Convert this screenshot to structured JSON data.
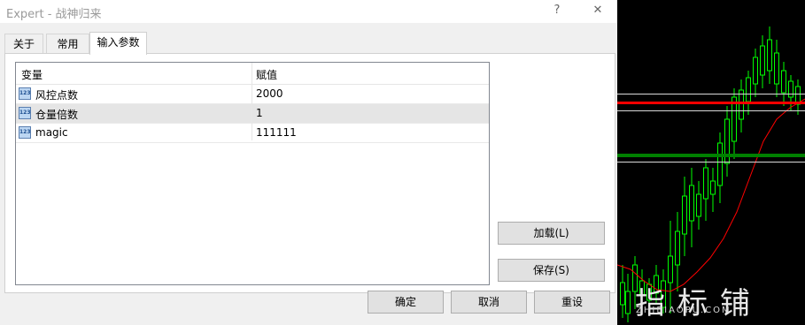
{
  "window": {
    "title": "Expert - 战神归来",
    "help_label": "?",
    "close_label": "✕"
  },
  "tabs": [
    {
      "label": "关于"
    },
    {
      "label": "常用"
    },
    {
      "label": "输入参数"
    }
  ],
  "table": {
    "columns": {
      "variable": "变量",
      "value": "赋值"
    },
    "rows": [
      {
        "icon": "integer-param-icon",
        "icon_text": "123",
        "name": "风控点数",
        "value": "2000"
      },
      {
        "icon": "integer-param-icon",
        "icon_text": "123",
        "name": "仓量倍数",
        "value": "1"
      },
      {
        "icon": "integer-param-icon",
        "icon_text": "123",
        "name": "magic",
        "value": "111111"
      }
    ],
    "selected_row": 1
  },
  "side_buttons": {
    "load": "加载(L)",
    "save": "保存(S)"
  },
  "footer_buttons": {
    "ok": "确定",
    "cancel": "取消",
    "reset": "重设"
  },
  "watermark": {
    "text": "指标铺",
    "sub": "ZHIBIAOPU.COM"
  },
  "colors": {
    "red_level": "#ff0000",
    "green_level": "#008000",
    "candle": "#00ff00",
    "ma": "#ff0000"
  }
}
